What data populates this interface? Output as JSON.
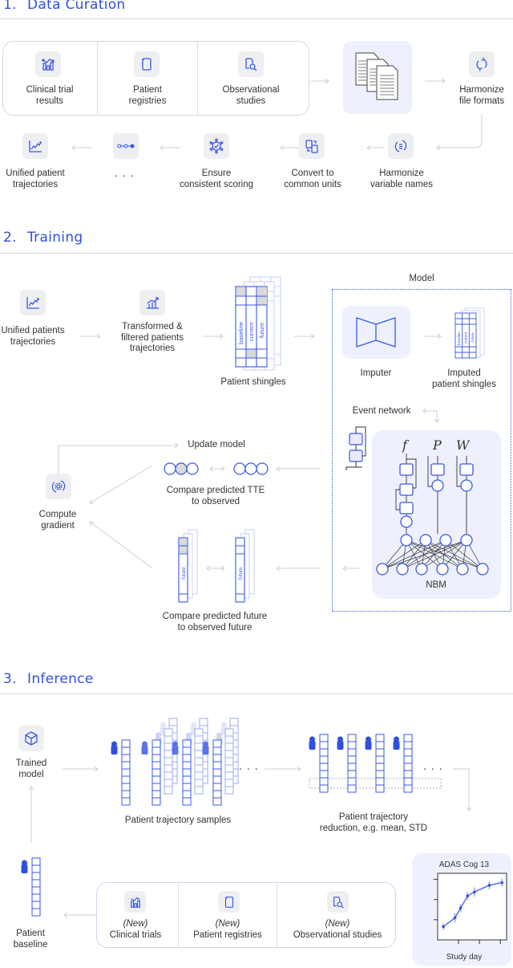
{
  "sections": {
    "curation": {
      "number": "1.",
      "title": "Data Curation"
    },
    "training": {
      "number": "2.",
      "title": "Training"
    },
    "inference": {
      "number": "3.",
      "title": "Inference"
    }
  },
  "curation": {
    "sources": [
      {
        "icon": "chart-icon",
        "label_1": "Clinical trial",
        "label_2": "results"
      },
      {
        "icon": "documents-icon",
        "label_1": "Patient",
        "label_2": "registries"
      },
      {
        "icon": "document-search-icon",
        "label_1": "Observational",
        "label_2": "studies"
      }
    ],
    "steps": [
      {
        "icon": "refresh-icon",
        "label_1": "Harmonize",
        "label_2": "file formats"
      },
      {
        "icon": "list-refresh-icon",
        "label_1": "Harmonize",
        "label_2": "variable names"
      },
      {
        "icon": "convert-icon",
        "label_1": "Convert to",
        "label_2": "common units"
      },
      {
        "icon": "badge-check-icon",
        "label_1": "Ensure",
        "label_2": "consistent scoring"
      },
      {
        "icon": "pipeline-icon",
        "label_1": "...",
        "label_2": ""
      },
      {
        "icon": "trend-chart-icon",
        "label_1": "Unified patient",
        "label_2": "trajectories"
      }
    ]
  },
  "training": {
    "unified": {
      "label_1": "Unified patients",
      "label_2": "trajectories"
    },
    "transformed": {
      "label_1": "Transformed &",
      "label_2": "filtered patients",
      "label_3": "trajectories"
    },
    "shingles": {
      "label": "Patient shingles",
      "cols": [
        "baseline",
        "current",
        "future"
      ]
    },
    "model": {
      "title": "Model",
      "imputer": "Imputer",
      "imputed_1": "Imputed",
      "imputed_2": "patient shingles",
      "event_network": "Event network",
      "nbm": "NBM",
      "symbols": [
        "f",
        "P",
        "W"
      ]
    },
    "update_model": "Update model",
    "compare_tte_1": "Compare predicted TTE",
    "compare_tte_2": "to observed",
    "compute_1": "Compute",
    "compute_2": "gradient",
    "compare_future_1": "Compare predicted future",
    "compare_future_2": "to observed future",
    "future_label": "future"
  },
  "inference": {
    "trained_1": "Trained",
    "trained_2": "model",
    "samples": "Patient trajectory samples",
    "reduction_1": "Patient trajectory",
    "reduction_2": "reduction, e.g. mean, STD",
    "baseline_1": "Patient",
    "baseline_2": "baseline",
    "new": "(New)",
    "new_sources": [
      "Clinical trials",
      "Patient registries",
      "Observational studies"
    ],
    "ellipsis": "..."
  },
  "chart_data": {
    "type": "line",
    "title": "ADAS Cog 13",
    "xlabel": "Study day",
    "ylabel": "",
    "x": [
      1,
      2,
      2.5,
      3.1,
      3.7,
      5.0,
      6.1
    ],
    "values": [
      1.0,
      1.65,
      2.4,
      3.3,
      3.6,
      4.1,
      4.3
    ],
    "error": [
      0.25,
      0.35,
      0.3,
      0.3,
      0.35,
      0.3,
      0.3
    ],
    "xlim": [
      0.5,
      6.5
    ],
    "ylim": [
      0,
      5
    ],
    "grid": false
  },
  "colors": {
    "accent": "#2f4fe0",
    "line": "#4a66f0",
    "arrow": "#cfcfcf",
    "tint": "#eef1fd"
  }
}
